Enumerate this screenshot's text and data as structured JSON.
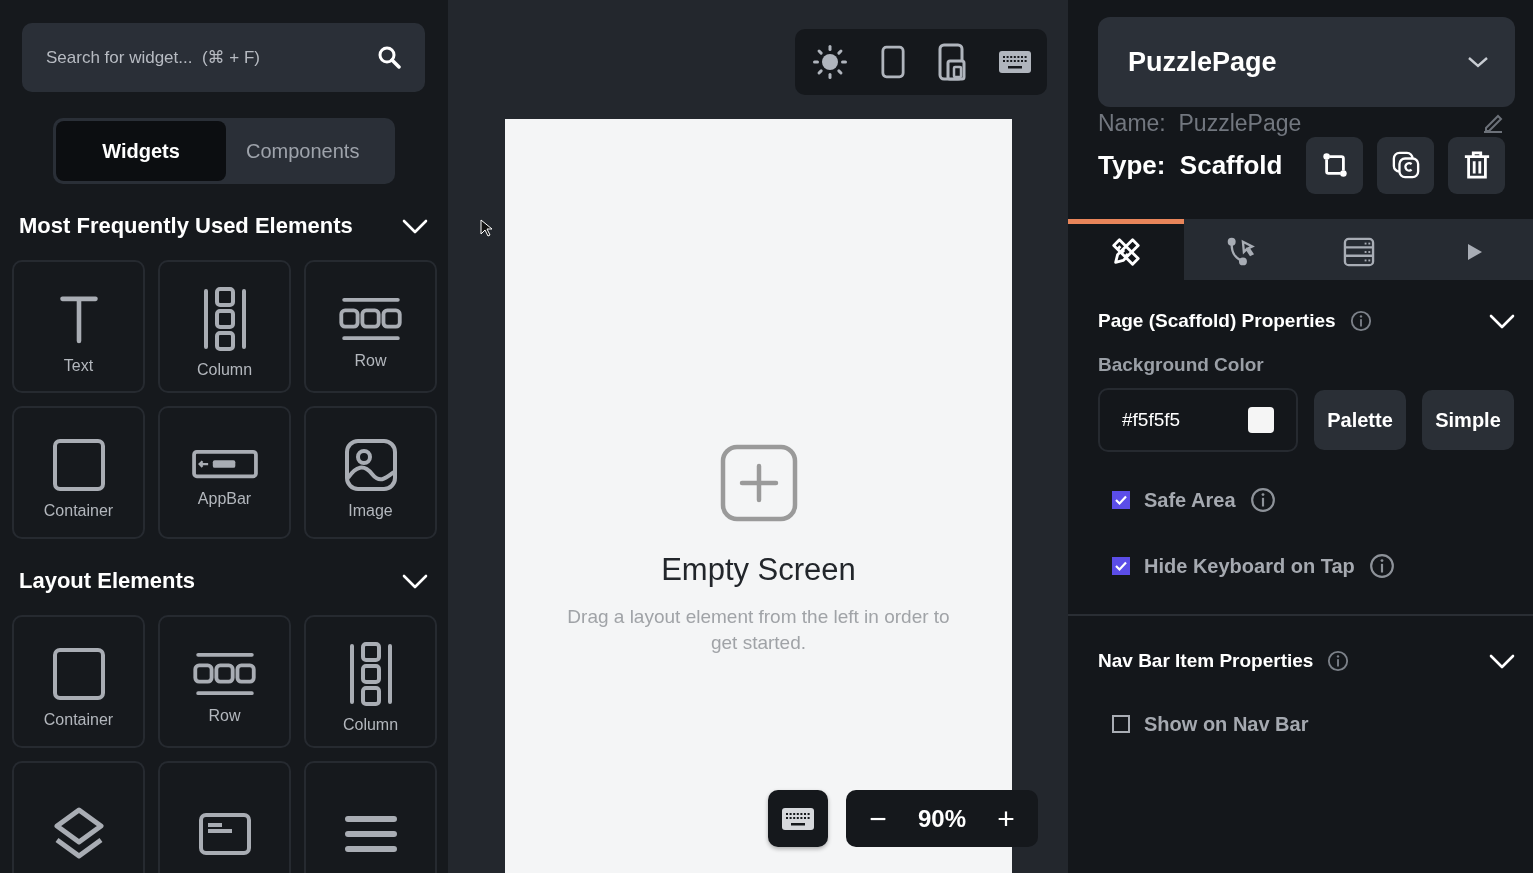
{
  "search": {
    "placeholder": "Search for widget...  (⌘ + F)"
  },
  "palette_tabs": [
    {
      "label": "Widgets",
      "selected": true
    },
    {
      "label": "Components",
      "selected": false
    }
  ],
  "sections": [
    {
      "title": "Most Frequently Used Elements",
      "expanded": true,
      "items": [
        {
          "kind": "text",
          "label": "Text"
        },
        {
          "kind": "column",
          "label": "Column"
        },
        {
          "kind": "row",
          "label": "Row"
        },
        {
          "kind": "container",
          "label": "Container"
        },
        {
          "kind": "appbar",
          "label": "AppBar"
        },
        {
          "kind": "image",
          "label": "Image"
        }
      ]
    },
    {
      "title": "Layout Elements",
      "expanded": true,
      "items": [
        {
          "kind": "container",
          "label": "Container"
        },
        {
          "kind": "row",
          "label": "Row"
        },
        {
          "kind": "column",
          "label": "Column"
        },
        {
          "kind": "stack"
        },
        {
          "kind": "card"
        },
        {
          "kind": "listview"
        }
      ]
    }
  ],
  "toolbar": [
    {
      "kind": "theme"
    },
    {
      "kind": "phone"
    },
    {
      "kind": "tablet"
    },
    {
      "kind": "keyboard"
    }
  ],
  "empty_state": {
    "title": "Empty Screen",
    "message": "Drag a layout element from the left in order to get started."
  },
  "zoom": {
    "decrease": "−",
    "value": "90%",
    "increase": "+"
  },
  "page_selector": {
    "title": "PuzzlePage"
  },
  "name_row": {
    "label": "Name:",
    "value": "PuzzlePage"
  },
  "type_row": {
    "label": "Type:",
    "value": "Scaffold"
  },
  "panel_tabs": [
    {
      "kind": "design",
      "selected": true
    },
    {
      "kind": "actions",
      "selected": false
    },
    {
      "kind": "backend",
      "selected": false
    },
    {
      "kind": "run",
      "selected": false
    }
  ],
  "property_sections": [
    {
      "title": "Page (Scaffold) Properties",
      "expanded": true,
      "background_label": "Background Color",
      "background_value": "#f5f5f5",
      "buttons": [
        "Palette",
        "Simple"
      ],
      "options": [
        {
          "label": "Safe Area",
          "checked": true,
          "info": true
        },
        {
          "label": "Hide Keyboard on Tap",
          "checked": true,
          "info": true
        }
      ]
    },
    {
      "title": "Nav Bar Item Properties",
      "expanded": true,
      "options": [
        {
          "label": "Show on Nav Bar",
          "checked": false,
          "info": false
        }
      ]
    }
  ]
}
